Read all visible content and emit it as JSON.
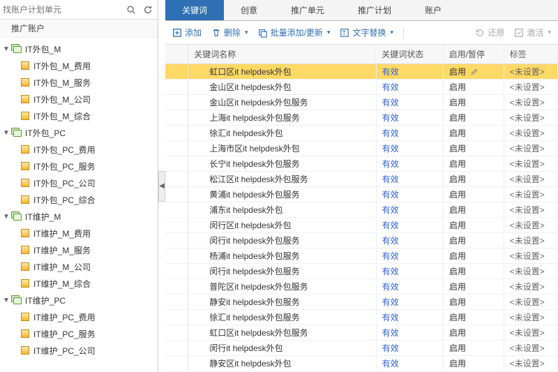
{
  "sidebar": {
    "search_placeholder": "找账户计划单元",
    "header": "推广账户",
    "groups": [
      {
        "label": "IT外包_M",
        "children": [
          "IT外包_M_费用",
          "IT外包_M_服务",
          "IT外包_M_公司",
          "IT外包_M_综合"
        ]
      },
      {
        "label": "IT外包_PC",
        "children": [
          "IT外包_PC_费用",
          "IT外包_PC_服务",
          "IT外包_PC_公司",
          "IT外包_PC_综合"
        ]
      },
      {
        "label": "IT维护_M",
        "children": [
          "IT维护_M_费用",
          "IT维护_M_服务",
          "IT维护_M_公司",
          "IT维护_M_综合"
        ]
      },
      {
        "label": "IT维护_PC",
        "children": [
          "IT维护_PC_费用",
          "IT维护_PC_服务",
          "IT维护_PC_公司"
        ]
      }
    ]
  },
  "tabs": [
    "关键词",
    "创意",
    "推广单元",
    "推广计划",
    "账户"
  ],
  "toolbar": {
    "add": "添加",
    "delete": "删除",
    "batch": "批量添加/更新",
    "replace": "文字替换",
    "restore": "还原",
    "activate": "激活"
  },
  "columns": {
    "name": "关键词名称",
    "status": "关键词状态",
    "toggle": "启用/暂停",
    "tag": "标签"
  },
  "cell": {
    "status_valid": "有效",
    "enable": "启用",
    "tag_unset": "<未设置>"
  },
  "rows": [
    {
      "name": "虹口区it helpdesk外包",
      "selected": true
    },
    {
      "name": "金山区it helpdesk外包"
    },
    {
      "name": "金山区it helpdesk外包服务"
    },
    {
      "name": "上海it helpdesk外包服务"
    },
    {
      "name": "徐汇it helpdesk外包"
    },
    {
      "name": "上海市区it helpdesk外包"
    },
    {
      "name": "长宁it helpdesk外包服务"
    },
    {
      "name": "松江区it helpdesk外包服务"
    },
    {
      "name": "黄浦it helpdesk外包服务"
    },
    {
      "name": "浦东it helpdesk外包"
    },
    {
      "name": "闵行区it helpdesk外包"
    },
    {
      "name": "闵行it helpdesk外包服务"
    },
    {
      "name": "杨浦it helpdesk外包服务"
    },
    {
      "name": "闵行it helpdesk外包服务"
    },
    {
      "name": "普陀区it helpdesk外包服务"
    },
    {
      "name": "静安it helpdesk外包服务"
    },
    {
      "name": "徐汇it helpdesk外包服务"
    },
    {
      "name": "虹口区it helpdesk外包服务"
    },
    {
      "name": "闵行it helpdesk外包"
    },
    {
      "name": "静安区it helpdesk外包"
    }
  ]
}
